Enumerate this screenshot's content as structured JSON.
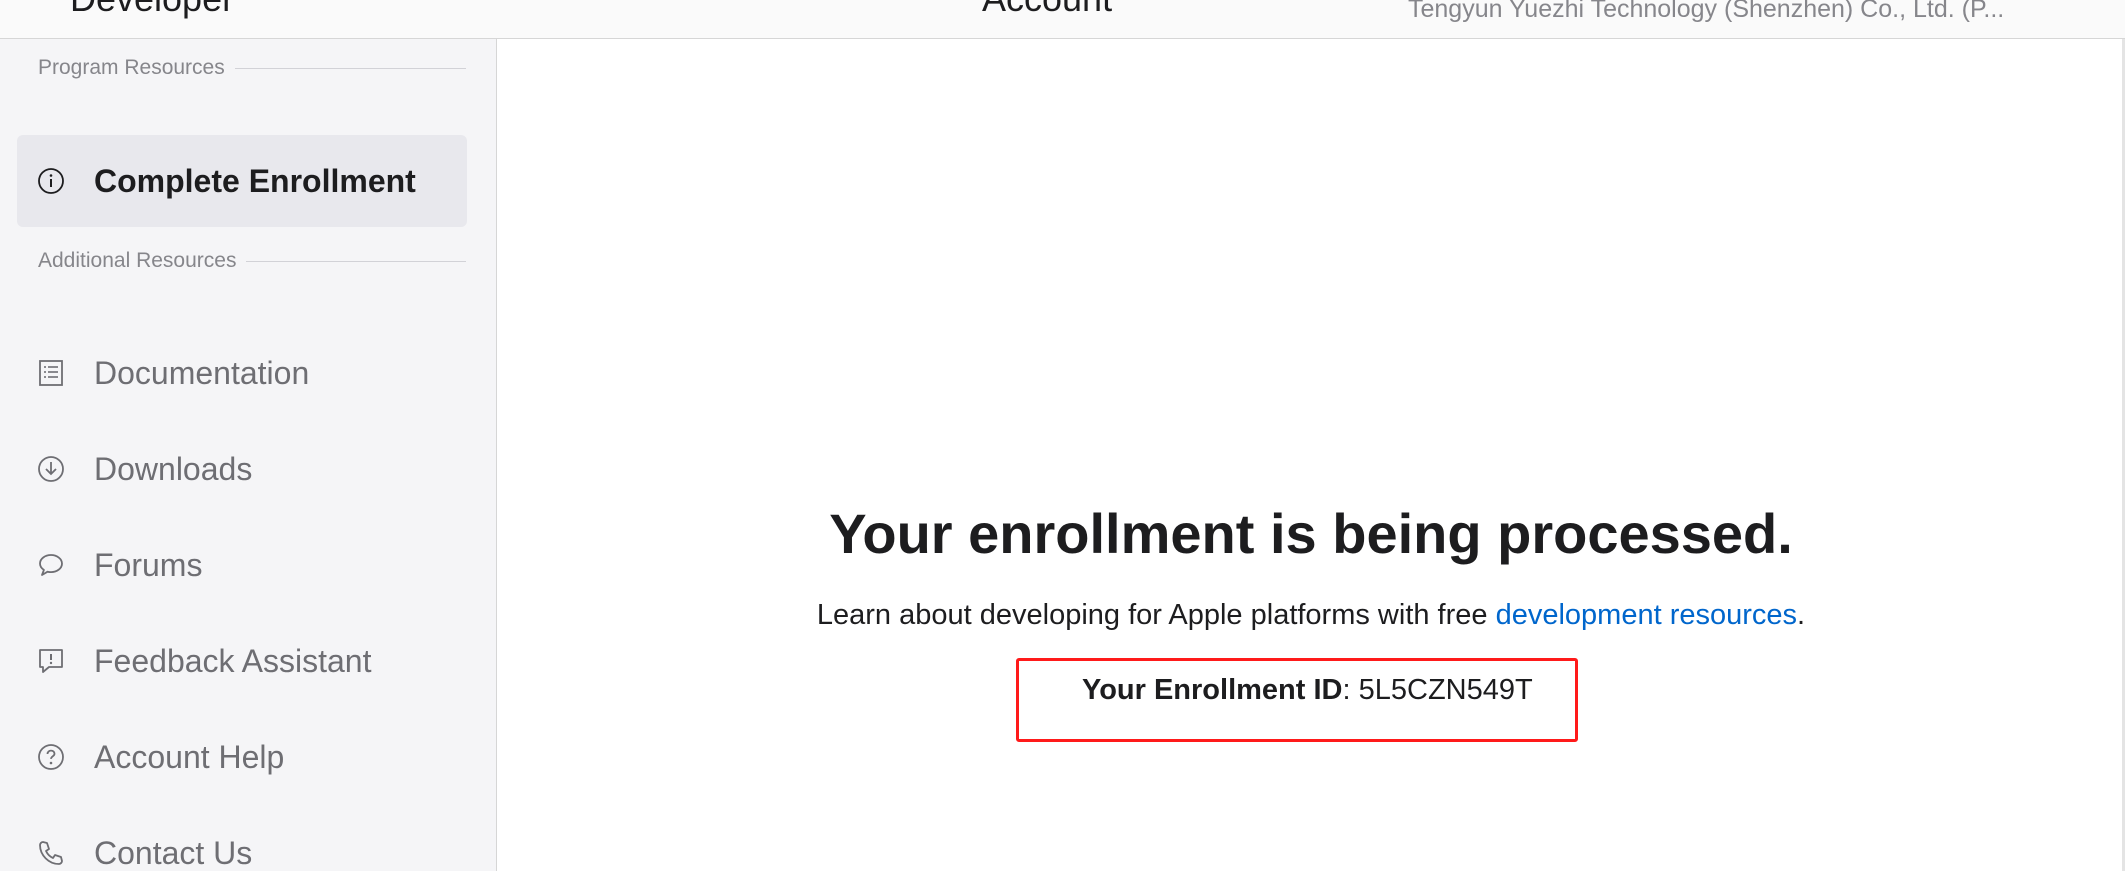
{
  "header": {
    "brand_label": "Developer",
    "page_title": "Account",
    "org_name": "Tengyun Yuezhi Technology (Shenzhen) Co., Ltd. (P..."
  },
  "sidebar": {
    "program_section": "Program Resources",
    "additional_section": "Additional Resources",
    "items": [
      {
        "label": "Complete Enrollment",
        "icon": "info-icon",
        "active": true
      },
      {
        "label": "Documentation",
        "icon": "document-icon"
      },
      {
        "label": "Downloads",
        "icon": "download-icon"
      },
      {
        "label": "Forums",
        "icon": "chat-bubble-icon"
      },
      {
        "label": "Feedback Assistant",
        "icon": "feedback-icon"
      },
      {
        "label": "Account Help",
        "icon": "question-icon"
      },
      {
        "label": "Contact Us",
        "icon": "phone-icon"
      }
    ]
  },
  "main": {
    "headline": "Your enrollment is being processed.",
    "subline_prefix": "Learn about developing for Apple platforms with free ",
    "subline_link": "development resources",
    "subline_suffix": ".",
    "enrollment_label": "Your Enrollment ID",
    "enrollment_sep": ": ",
    "enrollment_id": "5L5CZN549T"
  },
  "colors": {
    "link": "#0066cc",
    "highlight_box": "#ff1a1a",
    "sidebar_bg": "#f5f5f7",
    "active_item_bg": "#e8e8ed"
  }
}
